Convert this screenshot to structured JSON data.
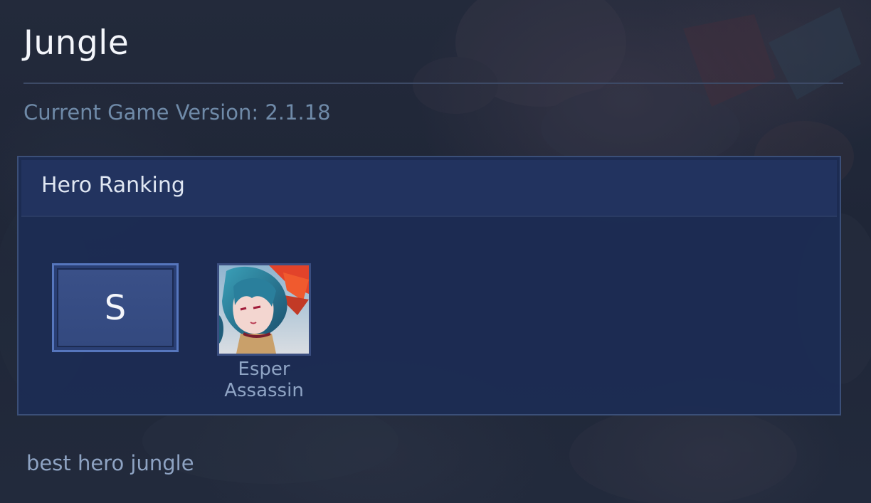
{
  "page": {
    "title": "Jungle",
    "version_text": "Current Game Version: 2.1.18",
    "footer_text": "best hero jungle"
  },
  "ranking_panel": {
    "title": "Hero Ranking",
    "tiers": [
      {
        "tier": "S",
        "heroes": [
          {
            "name": "Esper Assassin",
            "portrait_icon": "hero-portrait-icon"
          }
        ]
      }
    ]
  },
  "colors": {
    "background": "#222a3c",
    "panel": "#1c2c54",
    "panel_border": "#3b4f78",
    "tier_border": "#5676bd",
    "text_primary": "#f4f6fb",
    "text_muted": "#6f8aa8"
  }
}
